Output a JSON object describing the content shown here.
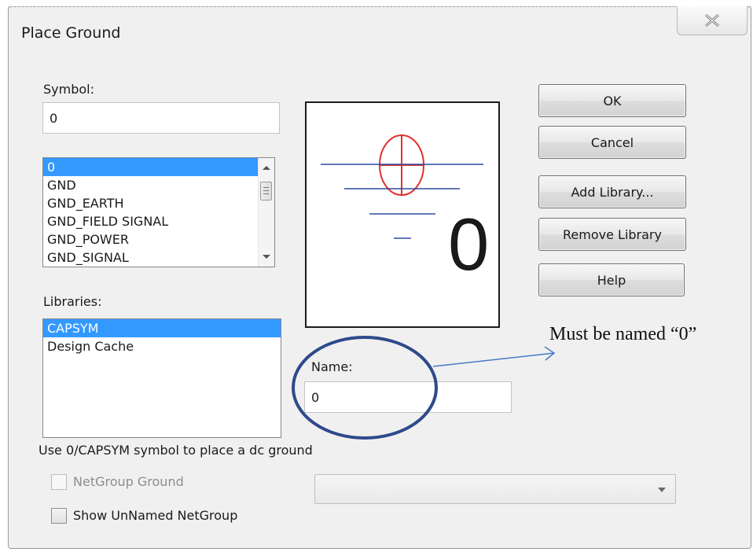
{
  "dialog": {
    "title": "Place Ground",
    "close_glyph": "✕"
  },
  "symbol": {
    "label": "Symbol:",
    "value": "0"
  },
  "symbol_list": {
    "items": [
      "0",
      "GND",
      "GND_EARTH",
      "GND_FIELD SIGNAL",
      "GND_POWER",
      "GND_SIGNAL"
    ],
    "selected_index": 0
  },
  "libraries": {
    "label": "Libraries:",
    "items": [
      "CAPSYM",
      "Design Cache"
    ],
    "selected_index": 0
  },
  "preview": {
    "big_label": "0"
  },
  "name": {
    "label": "Name:",
    "value": "0"
  },
  "buttons": {
    "ok": "OK",
    "cancel": "Cancel",
    "add_library": "Add Library...",
    "remove_library": "Remove Library",
    "help": "Help"
  },
  "hint": "Use 0/CAPSYM symbol to place a dc ground",
  "netgroup": {
    "label": "NetGroup Ground",
    "checked": false,
    "enabled": false
  },
  "show_unnamed": {
    "label": "Show UnNamed NetGroup",
    "checked": false
  },
  "annotation": {
    "text": "Must be named “0”",
    "color": "#2e4a8c"
  },
  "colors": {
    "selection": "#3399ff",
    "ground_symbol": "#e03030",
    "ground_lines": "#2e4aa0"
  }
}
